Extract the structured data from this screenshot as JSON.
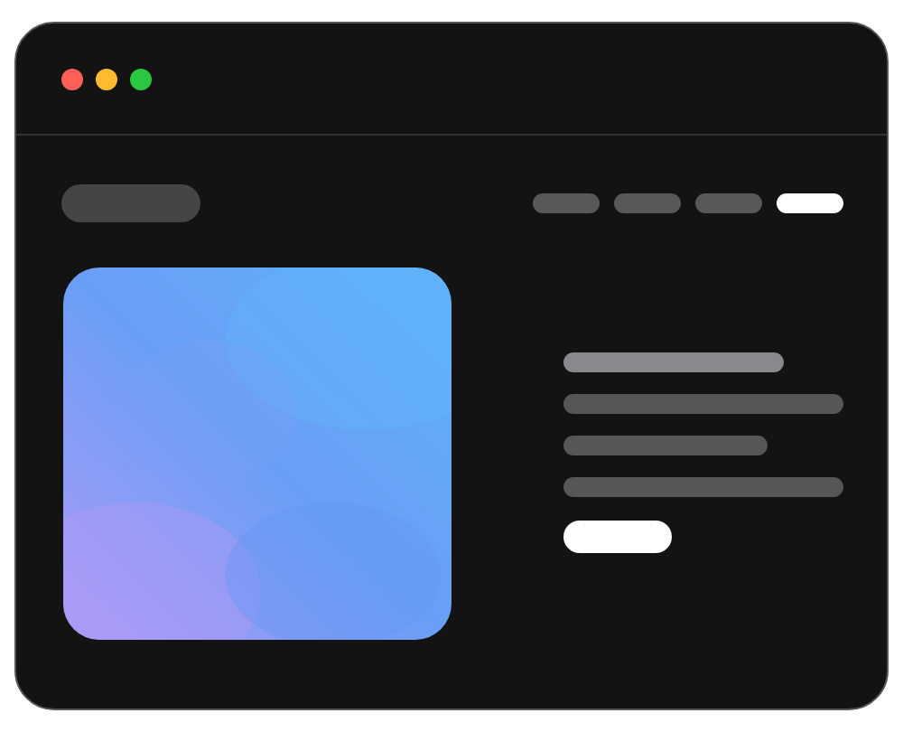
{
  "window": {
    "controls": [
      {
        "color": "#fe5f58"
      },
      {
        "color": "#febb2e"
      },
      {
        "color": "#29c840"
      }
    ]
  },
  "nav": {
    "items": [
      {
        "selected": false
      },
      {
        "selected": false
      },
      {
        "selected": false
      },
      {
        "selected": true
      }
    ]
  }
}
